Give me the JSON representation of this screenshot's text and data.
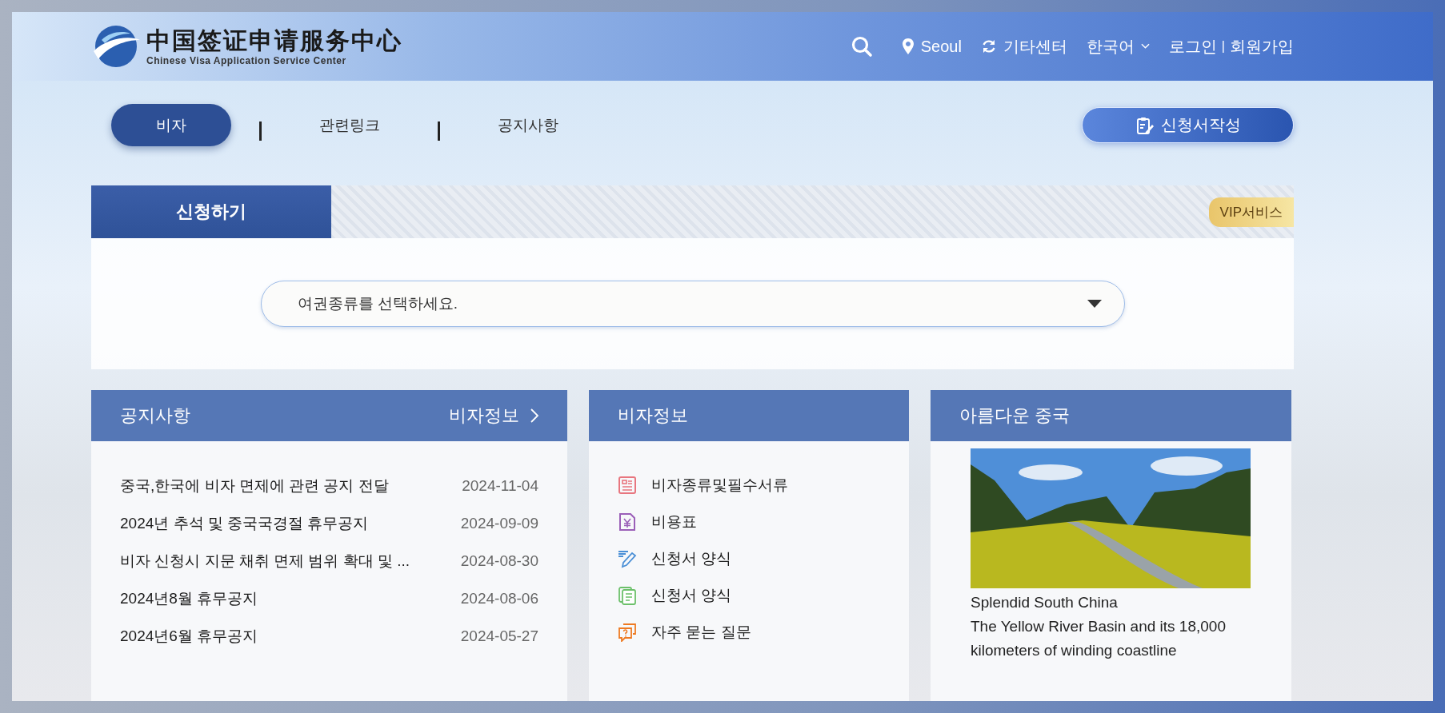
{
  "logo": {
    "chinese": "中国签证申请服务中心",
    "english": "Chinese Visa Application Service Center"
  },
  "header": {
    "location": "Seoul",
    "center": "기타센터",
    "language": "한국어",
    "login": "로그인",
    "separator": "|",
    "signup": "회원가입"
  },
  "nav": {
    "tabs": [
      {
        "label": "비자",
        "selected": true
      },
      {
        "label": "관련링크",
        "selected": false
      },
      {
        "label": "공지사항",
        "selected": false
      }
    ],
    "apply_button": "신청서작성"
  },
  "apply": {
    "title": "신청하기",
    "vip": "VIP서비스",
    "select": {
      "placeholder": "여권종류를 선택하세요."
    }
  },
  "notices": {
    "title": "공지사항",
    "more": "비자정보",
    "items": [
      {
        "title": "중국,한국에 비자 면제에 관련 공지 전달",
        "date": "2024-11-04"
      },
      {
        "title": "2024년 추석 및 중국국경절 휴무공지",
        "date": "2024-09-09"
      },
      {
        "title": "비자 신청시 지문 채취 면제 범위 확대 및 ...",
        "date": "2024-08-30"
      },
      {
        "title": "2024년8월 휴무공지",
        "date": "2024-08-06"
      },
      {
        "title": "2024년6월 휴무공지",
        "date": "2024-05-27"
      }
    ]
  },
  "visa_info": {
    "title": "비자정보",
    "items": [
      {
        "kind": "list",
        "label": "비자종류및필수서류"
      },
      {
        "kind": "fee",
        "label": "비용표"
      },
      {
        "kind": "pen",
        "label": "신청서 양식"
      },
      {
        "kind": "pages",
        "label": "신청서 양식"
      },
      {
        "kind": "faq",
        "label": "자주 묻는 질문"
      }
    ]
  },
  "china": {
    "title": "아름다운 중국",
    "caption": "Splendid South China",
    "text": "The Yellow River Basin and its 18,000 kilometers of winding coastline"
  }
}
